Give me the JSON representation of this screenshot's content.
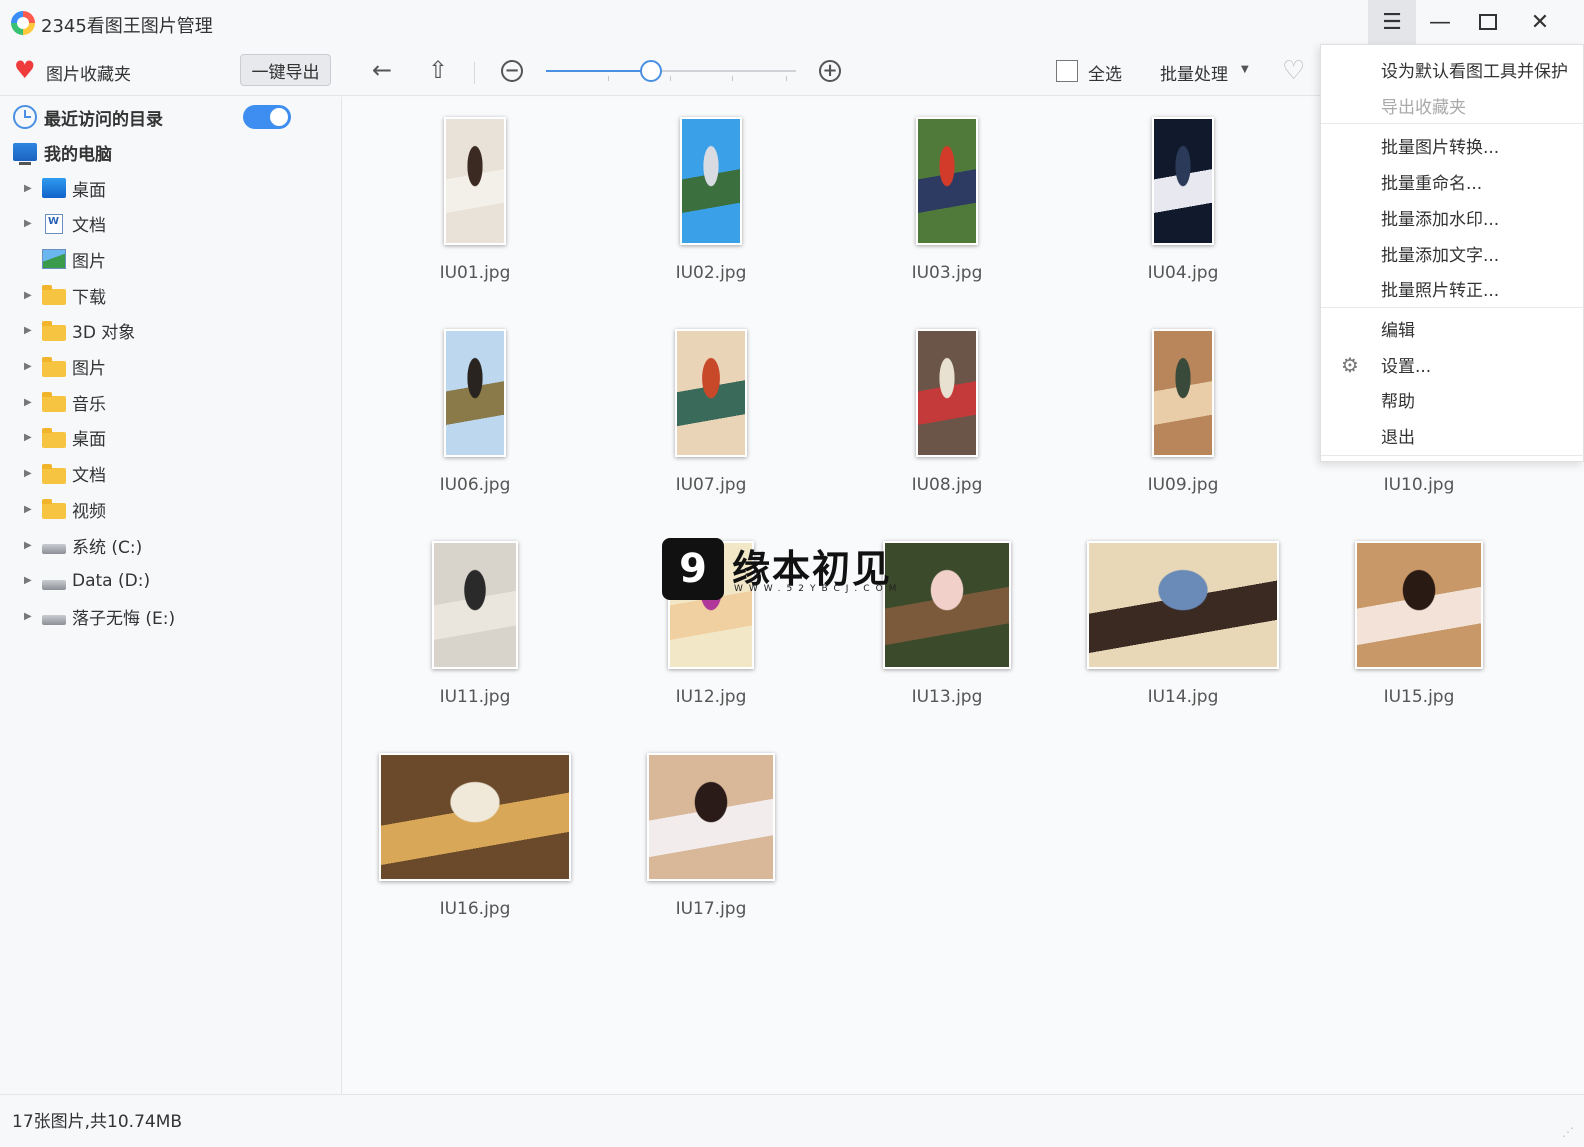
{
  "window": {
    "title": "2345看图王图片管理"
  },
  "toolbar": {
    "favorites_label": "图片收藏夹",
    "export_button": "一键导出",
    "select_all_label": "全选",
    "batch_label": "批量处理",
    "zoom_level": 0.42
  },
  "sidebar": {
    "recent_label": "最近访问的目录",
    "recent_toggle_on": true,
    "my_computer_label": "我的电脑",
    "items": [
      {
        "label": "桌面",
        "icon": "desktop-icon",
        "expandable": true
      },
      {
        "label": "文档",
        "icon": "document-icon",
        "expandable": true
      },
      {
        "label": "图片",
        "icon": "pictures-icon",
        "expandable": false
      },
      {
        "label": "下载",
        "icon": "folder-icon",
        "expandable": true
      },
      {
        "label": "3D 对象",
        "icon": "folder-icon",
        "expandable": true
      },
      {
        "label": "图片",
        "icon": "folder-icon",
        "expandable": true
      },
      {
        "label": "音乐",
        "icon": "folder-icon",
        "expandable": true
      },
      {
        "label": "桌面",
        "icon": "folder-icon",
        "expandable": true
      },
      {
        "label": "文档",
        "icon": "folder-icon",
        "expandable": true
      },
      {
        "label": "视频",
        "icon": "folder-icon",
        "expandable": true
      },
      {
        "label": "系统 (C:)",
        "icon": "drive-icon",
        "expandable": true
      },
      {
        "label": "Data (D:)",
        "icon": "drive-icon",
        "expandable": true
      },
      {
        "label": "落子无悔 (E:)",
        "icon": "drive-icon",
        "expandable": true
      }
    ]
  },
  "images": [
    {
      "name": "IU01.jpg",
      "orientation": "portrait",
      "colors": [
        "#e9e2d8",
        "#3a2a22",
        "#f3efe9"
      ]
    },
    {
      "name": "IU02.jpg",
      "orientation": "portrait",
      "colors": [
        "#3aa0e8",
        "#d8dce2",
        "#3b6f3e"
      ]
    },
    {
      "name": "IU03.jpg",
      "orientation": "portrait",
      "colors": [
        "#4f7a3a",
        "#d23b2a",
        "#2d3b63"
      ]
    },
    {
      "name": "IU04.jpg",
      "orientation": "portrait",
      "colors": [
        "#101a2c",
        "#2a3a58",
        "#e8e8f0"
      ]
    },
    {
      "name": "IU06.jpg",
      "orientation": "portrait",
      "colors": [
        "#bcd7ee",
        "#2a2420",
        "#8a7a4a"
      ]
    },
    {
      "name": "IU07.jpg",
      "orientation": "portrait",
      "colors": [
        "#e9d4b8",
        "#c8482a",
        "#3a6a5a"
      ]
    },
    {
      "name": "IU08.jpg",
      "orientation": "portrait",
      "colors": [
        "#6a5548",
        "#e8e0d0",
        "#c43a3a"
      ]
    },
    {
      "name": "IU09.jpg",
      "orientation": "portrait",
      "colors": [
        "#b8865a",
        "#3a4a3a",
        "#e8cda8"
      ]
    },
    {
      "name": "IU10.jpg",
      "orientation": "portrait",
      "colors": [
        "#cccccc",
        "#888888",
        "#eeeeee"
      ]
    },
    {
      "name": "IU11.jpg",
      "orientation": "portrait",
      "colors": [
        "#d8d4cc",
        "#2a2a2a",
        "#eae6de"
      ]
    },
    {
      "name": "IU12.jpg",
      "orientation": "portrait",
      "colors": [
        "#f2e8c8",
        "#b0389a",
        "#f0d0a0"
      ]
    },
    {
      "name": "IU13.jpg",
      "orientation": "landscape",
      "colors": [
        "#3a4a2a",
        "#f0d0c8",
        "#7a5a3a"
      ]
    },
    {
      "name": "IU14.jpg",
      "orientation": "landscape",
      "colors": [
        "#e8d8b8",
        "#6a8ab8",
        "#3a2a22"
      ]
    },
    {
      "name": "IU15.jpg",
      "orientation": "landscape",
      "colors": [
        "#c89868",
        "#2a1a14",
        "#f2e2d8"
      ]
    },
    {
      "name": "IU16.jpg",
      "orientation": "landscape",
      "colors": [
        "#6a4a2a",
        "#f0e8d8",
        "#d8a858"
      ]
    },
    {
      "name": "IU17.jpg",
      "orientation": "landscape",
      "colors": [
        "#d8b898",
        "#2a1a18",
        "#f2ecec"
      ]
    }
  ],
  "watermark": {
    "text": "缘本初见",
    "url": "WWW.52YBCJ.COM"
  },
  "menu": {
    "items": [
      {
        "label": "设为默认看图工具并保护",
        "disabled": false
      },
      {
        "label": "导出收藏夹",
        "disabled": true
      },
      {
        "label": "批量图片转换...",
        "disabled": false
      },
      {
        "label": "批量重命名...",
        "disabled": false
      },
      {
        "label": "批量添加水印...",
        "disabled": false
      },
      {
        "label": "批量添加文字...",
        "disabled": false
      },
      {
        "label": "批量照片转正...",
        "disabled": false
      },
      {
        "label": "编辑",
        "disabled": false
      },
      {
        "label": "设置...",
        "disabled": false,
        "icon": "gear-icon"
      },
      {
        "label": "帮助",
        "disabled": false
      },
      {
        "label": "退出",
        "disabled": false
      }
    ]
  },
  "status": {
    "text": "17张图片,共10.74MB"
  }
}
